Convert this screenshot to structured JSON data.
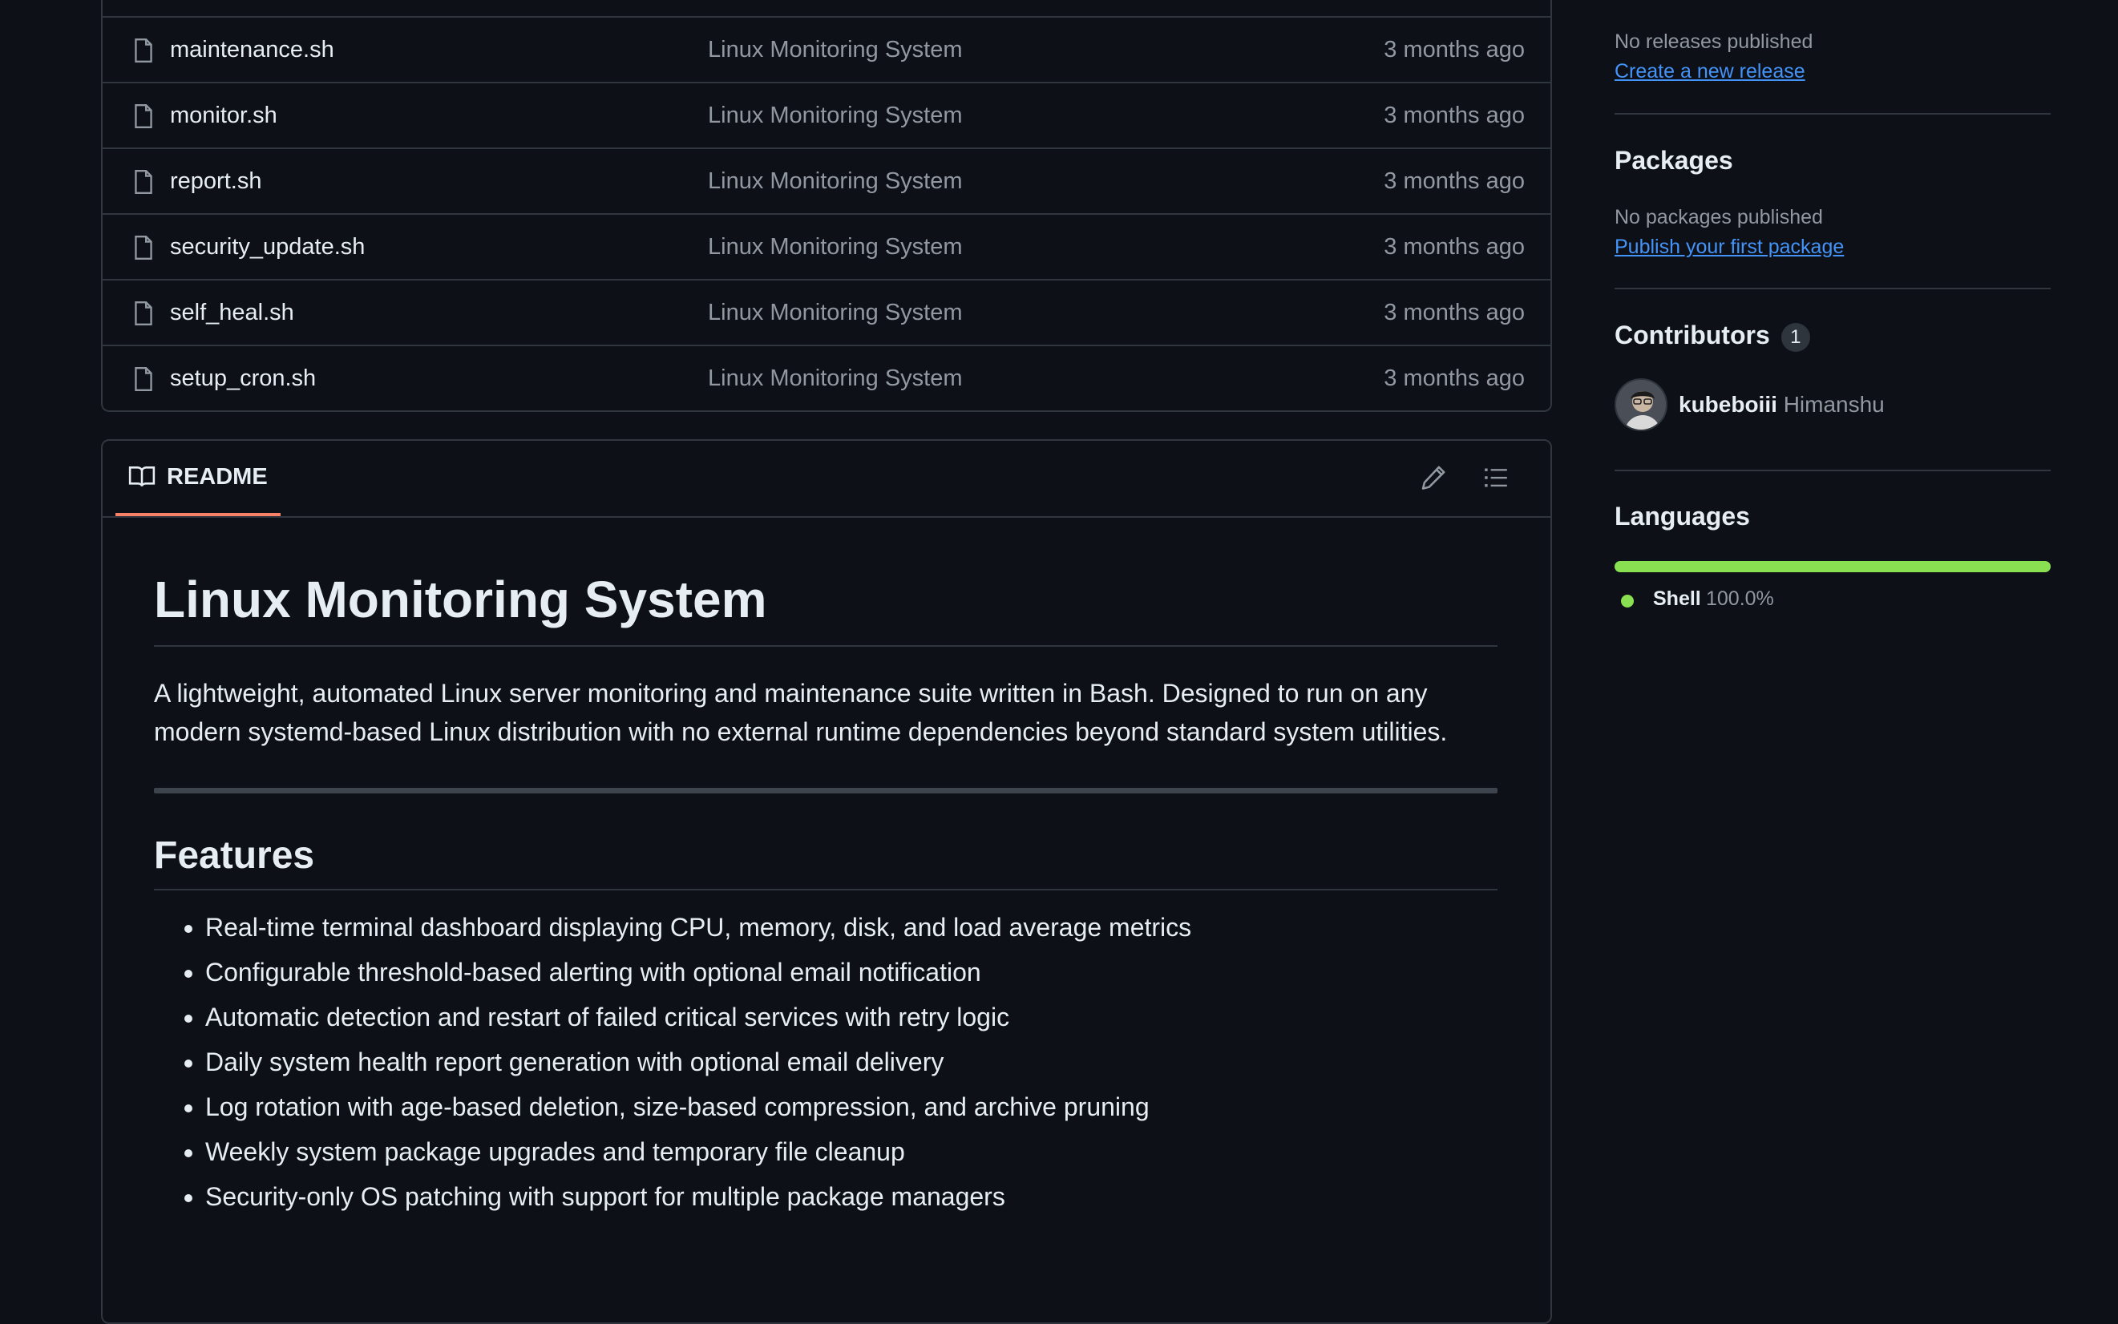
{
  "files": [
    {
      "name": "maintenance.sh",
      "commit": "Linux Monitoring System",
      "time": "3 months ago"
    },
    {
      "name": "monitor.sh",
      "commit": "Linux Monitoring System",
      "time": "3 months ago"
    },
    {
      "name": "report.sh",
      "commit": "Linux Monitoring System",
      "time": "3 months ago"
    },
    {
      "name": "security_update.sh",
      "commit": "Linux Monitoring System",
      "time": "3 months ago"
    },
    {
      "name": "self_heal.sh",
      "commit": "Linux Monitoring System",
      "time": "3 months ago"
    },
    {
      "name": "setup_cron.sh",
      "commit": "Linux Monitoring System",
      "time": "3 months ago"
    }
  ],
  "readme": {
    "tab_label": "README",
    "edit_icon": "pencil-icon",
    "outline_icon": "list-unordered-icon",
    "title": "Linux Monitoring System",
    "intro": "A lightweight, automated Linux server monitoring and maintenance suite written in Bash. Designed to run on any modern systemd-based Linux distribution with no external runtime dependencies beyond standard system utilities.",
    "features_heading": "Features",
    "features": [
      "Real-time terminal dashboard displaying CPU, memory, disk, and load average metrics",
      "Configurable threshold-based alerting with optional email notification",
      "Automatic detection and restart of failed critical services with retry logic",
      "Daily system health report generation with optional email delivery",
      "Log rotation with age-based deletion, size-based compression, and archive pruning",
      "Weekly system package upgrades and temporary file cleanup",
      "Security-only OS patching with support for multiple package managers"
    ]
  },
  "sidebar": {
    "releases": {
      "empty_text": "No releases published",
      "create_link": "Create a new release"
    },
    "packages": {
      "heading": "Packages",
      "empty_text": "No packages published",
      "publish_link": "Publish your first package"
    },
    "contributors": {
      "heading": "Contributors",
      "count": "1",
      "list": [
        {
          "login": "kubeboiii",
          "name": "Himanshu"
        }
      ]
    },
    "languages": {
      "heading": "Languages",
      "items": [
        {
          "name": "Shell",
          "percent": "100.0%",
          "color": "#89e051"
        }
      ]
    }
  },
  "colors": {
    "background": "#0d1117",
    "border": "#30363d",
    "muted": "#9198a1",
    "link": "#4493f8",
    "tab_underline": "#f78166",
    "shell": "#89e051"
  }
}
